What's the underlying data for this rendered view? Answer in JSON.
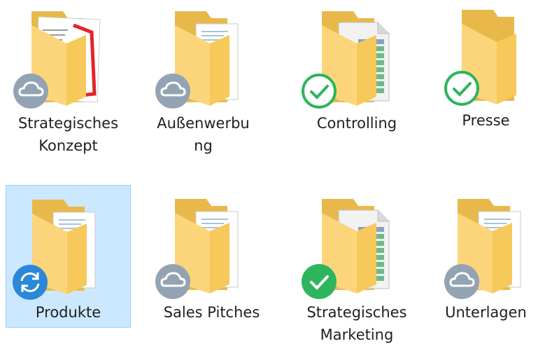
{
  "items": [
    {
      "label_lines": [
        "Strategisches",
        "Konzept"
      ],
      "content": "red-document",
      "status": "cloud",
      "selected": false
    },
    {
      "label_lines": [
        "Außenwerbu",
        "ng"
      ],
      "content": "papers",
      "status": "cloud",
      "selected": false
    },
    {
      "label_lines": [
        "Controlling",
        ""
      ],
      "content": "excel",
      "status": "check-outline",
      "selected": false
    },
    {
      "label_lines": [
        "Presse",
        ""
      ],
      "content": "empty",
      "status": "check-outline",
      "selected": false
    },
    {
      "label_lines": [
        "Produkte",
        ""
      ],
      "content": "papers",
      "status": "sync",
      "selected": true
    },
    {
      "label_lines": [
        "Sales Pitches",
        ""
      ],
      "content": "papers",
      "status": "cloud",
      "selected": false
    },
    {
      "label_lines": [
        "Strategisches",
        "Marketing"
      ],
      "content": "excel",
      "status": "check-filled",
      "selected": false
    },
    {
      "label_lines": [
        "Unterlagen",
        ""
      ],
      "content": "papers",
      "status": "cloud",
      "selected": false
    }
  ],
  "colors": {
    "folder_back": "#e8b94a",
    "folder_front": "#fcd57b",
    "cloud_badge": "#93a3b3",
    "check_green": "#2db55d",
    "sync_blue": "#2b88d9",
    "excel_green": "#1e7145",
    "selection_bg": "#cce8ff"
  }
}
